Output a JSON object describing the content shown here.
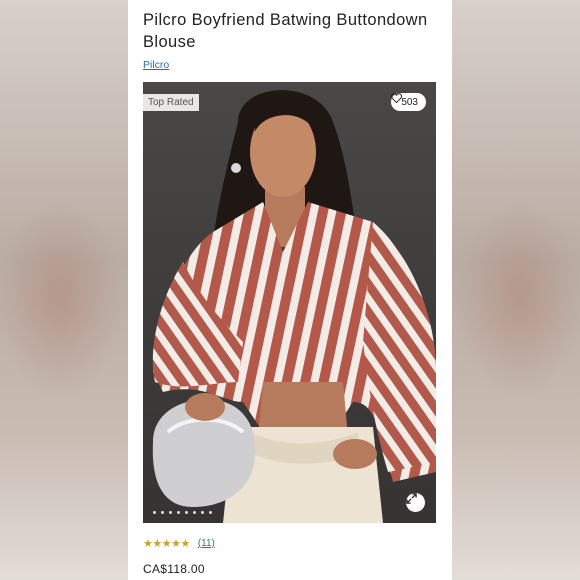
{
  "product": {
    "title": "Pilcro Boyfriend Batwing Buttondown Blouse",
    "brand": "Pilcro",
    "badge": "Top Rated",
    "likes": "503",
    "rating_stars": "★★★★★",
    "rating_value": 4.5,
    "review_count": "(11)",
    "price": "CA$118.00"
  },
  "gallery": {
    "dot_count": 8,
    "icons": {
      "like": "heart-icon",
      "expand": "expand-icon"
    }
  },
  "colors": {
    "link": "#2f6fa6",
    "star": "#c9a227",
    "stripe": "#b4584a"
  }
}
